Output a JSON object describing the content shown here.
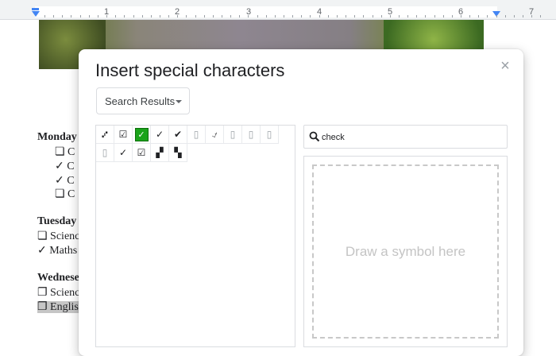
{
  "ruler": {
    "numbers": [
      "1",
      "2",
      "3",
      "4",
      "5",
      "6",
      "7"
    ]
  },
  "document": {
    "monday_heading": "Monday",
    "monday_items": [
      "❏  C",
      "✓  C",
      "✓  C",
      "❏  C"
    ],
    "tuesday_heading": "Tuesday",
    "tuesday_items": [
      "❏ Scienc",
      "✓ Maths"
    ],
    "wednesday_heading": "Wednese",
    "wednesday_items": [
      "❐ Scienc",
      "❐ English"
    ]
  },
  "dialog": {
    "title": "Insert special characters",
    "close_glyph": "×",
    "category_dropdown": "Search Results",
    "search": {
      "value": "check",
      "icon": "search-icon"
    },
    "draw_hint": "Draw a symbol here",
    "symbols": [
      "⑇",
      "☑",
      "✅",
      "✓",
      "✔",
      "▯",
      "⍻",
      "▯",
      "▯",
      "▯",
      "▯",
      "✓",
      "☑",
      "▞",
      "▚"
    ],
    "selected_index": 2
  }
}
